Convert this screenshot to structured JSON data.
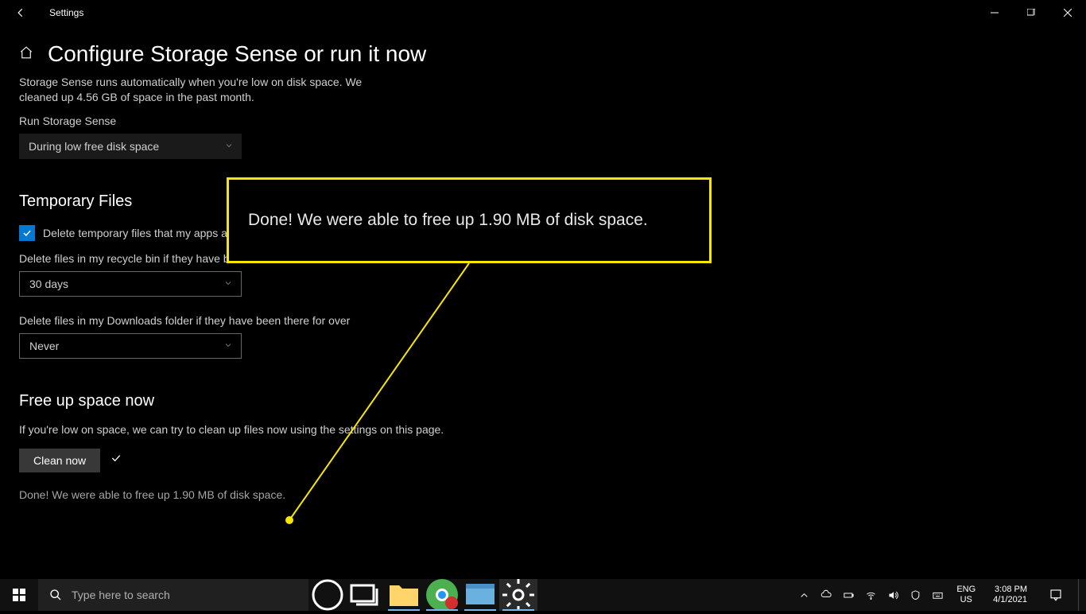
{
  "window": {
    "title": "Settings"
  },
  "header": {
    "title": "Configure Storage Sense or run it now"
  },
  "intro": {
    "desc": "Storage Sense runs automatically when you're low on disk space. We cleaned up 4.56 GB of space in the past month.",
    "run_label": "Run Storage Sense",
    "run_value": "During low free disk space"
  },
  "temp": {
    "title": "Temporary Files",
    "cb_label": "Delete temporary files that my apps aren't using",
    "recycle_label": "Delete files in my recycle bin if they have been there for over",
    "recycle_value": "30 days",
    "downloads_label": "Delete files in my Downloads folder if they have been there for over",
    "downloads_value": "Never"
  },
  "free": {
    "title": "Free up space now",
    "desc": "If you're low on space, we can try to clean up files now using the settings on this page.",
    "btn": "Clean now",
    "done": "Done! We were able to free up 1.90 MB of disk space."
  },
  "callout": {
    "text": "Done! We were able to free up 1.90 MB of disk space."
  },
  "taskbar": {
    "search_ph": "Type here to search",
    "lang1": "ENG",
    "lang2": "US",
    "time": "3:08 PM",
    "date": "4/1/2021"
  }
}
